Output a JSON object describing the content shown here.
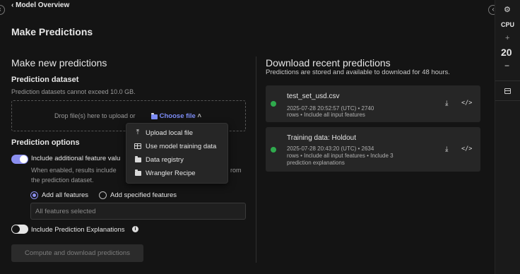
{
  "header": {
    "back_label": "Model Overview",
    "page_title": "Make Predictions"
  },
  "left": {
    "section_title": "Make new predictions",
    "dataset_label": "Prediction dataset",
    "dataset_hint": "Prediction datasets cannot exceed 10.0 GB.",
    "drop_text": "Drop file(s) here to upload or",
    "choose_file": "Choose file",
    "options_title": "Prediction options",
    "include_features_label": "Include additional feature valu",
    "include_features_desc_1": "When enabled, results include",
    "include_features_desc_1b": "rom",
    "include_features_desc_2": "the prediction dataset.",
    "radio_all": "Add all features",
    "radio_specified": "Add specified features",
    "features_input_value": "All features selected",
    "explanations_label": "Include Prediction Explanations",
    "compute_button": "Compute and download predictions"
  },
  "dropdown": {
    "items": [
      {
        "label": "Upload local file",
        "icon": "upload-icon"
      },
      {
        "label": "Use model training data",
        "icon": "table-icon"
      },
      {
        "label": "Data registry",
        "icon": "folder-icon"
      },
      {
        "label": "Wrangler Recipe",
        "icon": "folder-icon"
      }
    ]
  },
  "right": {
    "section_title": "Download recent predictions",
    "subtitle": "Predictions are stored and available to download for 48 hours.",
    "cards": [
      {
        "name": "test_set_usd.csv",
        "meta_1": "2025-07-28 20:52:57 (UTC)  •  2740",
        "meta_2": "rows  •  Include all input features",
        "meta_3": ""
      },
      {
        "name": "Training data: Holdout",
        "meta_1": "2025-07-28 20:43:20 (UTC)  •  2634",
        "meta_2": "rows  •  Include all input features  •  Include 3",
        "meta_3": "prediction explanations"
      }
    ]
  },
  "rail": {
    "cpu_label": "CPU",
    "plus": "+",
    "cpu_value": "20",
    "minus": "−"
  },
  "colors": {
    "accent": "#8b8ff0",
    "link": "#7c8cf5",
    "success": "#2faa4d",
    "background": "#141414"
  }
}
